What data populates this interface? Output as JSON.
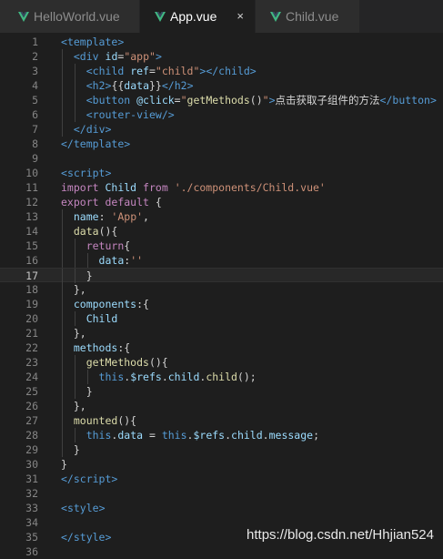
{
  "tabs": [
    {
      "label": "HelloWorld.vue",
      "active": false
    },
    {
      "label": "App.vue",
      "active": true,
      "close": "×"
    },
    {
      "label": "Child.vue",
      "active": false
    }
  ],
  "colors": {
    "tag": "#569cd6",
    "attr": "#9cdcfe",
    "string": "#ce9178",
    "keyword": "#c586c0",
    "func": "#dcdcaa",
    "text": "#d4d4d4",
    "vue_green": "#41b883"
  },
  "icons": {
    "tab_file": "vue-icon",
    "tab_close": "close-icon"
  },
  "current_line": 17,
  "lines": [
    {
      "n": "1",
      "tokens": [
        [
          "<",
          "tag"
        ],
        [
          "template",
          "tag"
        ],
        [
          ">",
          "tag"
        ]
      ]
    },
    {
      "n": "2",
      "tokens": [
        [
          "  ",
          "text"
        ],
        [
          "<",
          "tag"
        ],
        [
          "div",
          "tag"
        ],
        [
          " ",
          "text"
        ],
        [
          "id",
          "attr"
        ],
        [
          "=",
          "text"
        ],
        [
          "\"app\"",
          "string"
        ],
        [
          ">",
          "tag"
        ]
      ]
    },
    {
      "n": "3",
      "tokens": [
        [
          "    ",
          "text"
        ],
        [
          "<",
          "tag"
        ],
        [
          "child",
          "tag"
        ],
        [
          " ",
          "text"
        ],
        [
          "ref",
          "attr"
        ],
        [
          "=",
          "text"
        ],
        [
          "\"child\"",
          "string"
        ],
        [
          "></",
          "tag"
        ],
        [
          "child",
          "tag"
        ],
        [
          ">",
          "tag"
        ]
      ]
    },
    {
      "n": "4",
      "tokens": [
        [
          "    ",
          "text"
        ],
        [
          "<",
          "tag"
        ],
        [
          "h2",
          "tag"
        ],
        [
          ">",
          "tag"
        ],
        [
          "{{",
          "text"
        ],
        [
          "data",
          "attr"
        ],
        [
          "}}",
          "text"
        ],
        [
          "</",
          "tag"
        ],
        [
          "h2",
          "tag"
        ],
        [
          ">",
          "tag"
        ]
      ]
    },
    {
      "n": "5",
      "tokens": [
        [
          "    ",
          "text"
        ],
        [
          "<",
          "tag"
        ],
        [
          "button",
          "tag"
        ],
        [
          " ",
          "text"
        ],
        [
          "@click",
          "attr"
        ],
        [
          "=",
          "text"
        ],
        [
          "\"",
          "string"
        ],
        [
          "getMethods",
          "func"
        ],
        [
          "()",
          "text"
        ],
        [
          "\"",
          "string"
        ],
        [
          ">",
          "tag"
        ],
        [
          "点击获取子组件的方法",
          "text"
        ],
        [
          "</",
          "tag"
        ],
        [
          "button",
          "tag"
        ],
        [
          ">",
          "tag"
        ]
      ]
    },
    {
      "n": "6",
      "tokens": [
        [
          "    ",
          "text"
        ],
        [
          "<",
          "tag"
        ],
        [
          "router-view",
          "tag"
        ],
        [
          "/>",
          "tag"
        ]
      ]
    },
    {
      "n": "7",
      "tokens": [
        [
          "  ",
          "text"
        ],
        [
          "</",
          "tag"
        ],
        [
          "div",
          "tag"
        ],
        [
          ">",
          "tag"
        ]
      ]
    },
    {
      "n": "8",
      "tokens": [
        [
          "</",
          "tag"
        ],
        [
          "template",
          "tag"
        ],
        [
          ">",
          "tag"
        ]
      ]
    },
    {
      "n": "9",
      "tokens": []
    },
    {
      "n": "10",
      "tokens": [
        [
          "<",
          "tag"
        ],
        [
          "script",
          "tag"
        ],
        [
          ">",
          "tag"
        ]
      ]
    },
    {
      "n": "11",
      "tokens": [
        [
          "import",
          "keyword"
        ],
        [
          " ",
          "text"
        ],
        [
          "Child",
          "attr"
        ],
        [
          " ",
          "text"
        ],
        [
          "from",
          "keyword"
        ],
        [
          " ",
          "text"
        ],
        [
          "'./components/Child.vue'",
          "string"
        ]
      ]
    },
    {
      "n": "12",
      "tokens": [
        [
          "export",
          "keyword"
        ],
        [
          " ",
          "text"
        ],
        [
          "default",
          "keyword"
        ],
        [
          " {",
          "text"
        ]
      ]
    },
    {
      "n": "13",
      "tokens": [
        [
          "  ",
          "text"
        ],
        [
          "name",
          "attr"
        ],
        [
          ": ",
          "text"
        ],
        [
          "'App'",
          "string"
        ],
        [
          ",",
          "text"
        ]
      ]
    },
    {
      "n": "14",
      "tokens": [
        [
          "  ",
          "text"
        ],
        [
          "data",
          "func"
        ],
        [
          "(){",
          "text"
        ]
      ]
    },
    {
      "n": "15",
      "tokens": [
        [
          "    ",
          "text"
        ],
        [
          "return",
          "keyword"
        ],
        [
          "{",
          "text"
        ]
      ]
    },
    {
      "n": "16",
      "tokens": [
        [
          "      ",
          "text"
        ],
        [
          "data",
          "attr"
        ],
        [
          ":",
          "text"
        ],
        [
          "''",
          "string"
        ]
      ]
    },
    {
      "n": "17",
      "tokens": [
        [
          "    ",
          "text"
        ],
        [
          "}",
          "text"
        ]
      ]
    },
    {
      "n": "18",
      "tokens": [
        [
          "  ",
          "text"
        ],
        [
          "},",
          "text"
        ]
      ]
    },
    {
      "n": "19",
      "tokens": [
        [
          "  ",
          "text"
        ],
        [
          "components",
          "attr"
        ],
        [
          ":{",
          "text"
        ]
      ]
    },
    {
      "n": "20",
      "tokens": [
        [
          "    ",
          "text"
        ],
        [
          "Child",
          "attr"
        ]
      ]
    },
    {
      "n": "21",
      "tokens": [
        [
          "  ",
          "text"
        ],
        [
          "},",
          "text"
        ]
      ]
    },
    {
      "n": "22",
      "tokens": [
        [
          "  ",
          "text"
        ],
        [
          "methods",
          "attr"
        ],
        [
          ":{",
          "text"
        ]
      ]
    },
    {
      "n": "23",
      "tokens": [
        [
          "    ",
          "text"
        ],
        [
          "getMethods",
          "func"
        ],
        [
          "(){",
          "text"
        ]
      ]
    },
    {
      "n": "24",
      "tokens": [
        [
          "      ",
          "text"
        ],
        [
          "this",
          "tag"
        ],
        [
          ".",
          "text"
        ],
        [
          "$refs",
          "attr"
        ],
        [
          ".",
          "text"
        ],
        [
          "child",
          "attr"
        ],
        [
          ".",
          "text"
        ],
        [
          "child",
          "func"
        ],
        [
          "();",
          "text"
        ]
      ]
    },
    {
      "n": "25",
      "tokens": [
        [
          "    ",
          "text"
        ],
        [
          "}",
          "text"
        ]
      ]
    },
    {
      "n": "26",
      "tokens": [
        [
          "  ",
          "text"
        ],
        [
          "},",
          "text"
        ]
      ]
    },
    {
      "n": "27",
      "tokens": [
        [
          "  ",
          "text"
        ],
        [
          "mounted",
          "func"
        ],
        [
          "(){",
          "text"
        ]
      ]
    },
    {
      "n": "28",
      "tokens": [
        [
          "    ",
          "text"
        ],
        [
          "this",
          "tag"
        ],
        [
          ".",
          "text"
        ],
        [
          "data",
          "attr"
        ],
        [
          " = ",
          "text"
        ],
        [
          "this",
          "tag"
        ],
        [
          ".",
          "text"
        ],
        [
          "$refs",
          "attr"
        ],
        [
          ".",
          "text"
        ],
        [
          "child",
          "attr"
        ],
        [
          ".",
          "text"
        ],
        [
          "message",
          "attr"
        ],
        [
          ";",
          "text"
        ]
      ]
    },
    {
      "n": "29",
      "tokens": [
        [
          "  ",
          "text"
        ],
        [
          "}",
          "text"
        ]
      ]
    },
    {
      "n": "30",
      "tokens": [
        [
          "}",
          "text"
        ]
      ]
    },
    {
      "n": "31",
      "tokens": [
        [
          "</",
          "tag"
        ],
        [
          "script",
          "tag"
        ],
        [
          ">",
          "tag"
        ]
      ]
    },
    {
      "n": "32",
      "tokens": []
    },
    {
      "n": "33",
      "tokens": [
        [
          "<",
          "tag"
        ],
        [
          "style",
          "tag"
        ],
        [
          ">",
          "tag"
        ]
      ]
    },
    {
      "n": "34",
      "tokens": []
    },
    {
      "n": "35",
      "tokens": [
        [
          "</",
          "tag"
        ],
        [
          "style",
          "tag"
        ],
        [
          ">",
          "tag"
        ]
      ]
    },
    {
      "n": "36",
      "tokens": []
    }
  ],
  "watermark": "https://blog.csdn.net/Hhjian524"
}
